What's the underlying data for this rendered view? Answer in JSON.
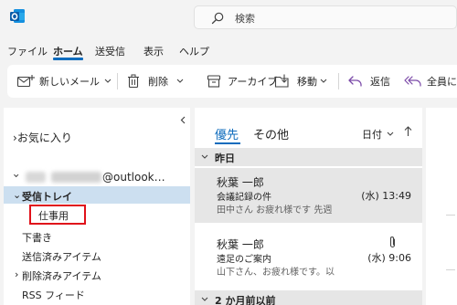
{
  "colors": {
    "accent": "#0f6cbd",
    "highlight_box": "#e0111a",
    "selected_folder": "#ccdff0",
    "selected_message": "#e6e6e6"
  },
  "search": {
    "placeholder": "検索",
    "icon": "search-icon"
  },
  "menubar": {
    "file": "ファイル",
    "home": "ホーム",
    "send_receive": "送受信",
    "view": "表示",
    "help": "ヘルプ"
  },
  "ribbon": {
    "new_mail": "新しいメール",
    "delete": "削除",
    "archive": "アーカイブ",
    "move": "移動",
    "reply": "返信",
    "reply_all": "全員に"
  },
  "folders": {
    "favorites": "お気に入り",
    "account": "@outlook…",
    "inbox": "受信トレイ",
    "subfolder": "仕事用",
    "drafts": "下書き",
    "sent": "送信済みアイテム",
    "deleted": "削除済みアイテム",
    "rss": "RSS フィード"
  },
  "list": {
    "tab_focused": "優先",
    "tab_other": "その他",
    "sort_label": "日付",
    "groups": {
      "yesterday": "昨日",
      "two_months": "2 か月前以前"
    },
    "messages": [
      {
        "from": "秋葉 一郎",
        "subject": "会議記録の件",
        "preview": "田中さん お疲れ様です 先週",
        "time": "(水) 13:49"
      },
      {
        "from": "秋葉 一郎",
        "subject": "遠足のご案内",
        "preview": "山下さん、お疲れ様です。以",
        "time": "(水) 9:06"
      }
    ]
  }
}
